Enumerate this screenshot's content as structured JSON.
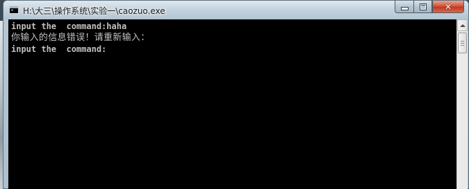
{
  "window": {
    "title": "H:\\大三\\操作系统\\实验一\\caozuo.exe",
    "icon": "console-app-icon"
  },
  "controls": {
    "minimize": "minimize",
    "maximize": "maximize",
    "close": "✕"
  },
  "console": {
    "lines": [
      "input the  command:haha",
      "你输入的信息错误！请重新输入：",
      "input the  command:"
    ],
    "background": "#000000",
    "foreground": "#c0c0c0"
  },
  "colors": {
    "close_button": "#c23a1f",
    "titlebar": "#c3d2dd"
  }
}
